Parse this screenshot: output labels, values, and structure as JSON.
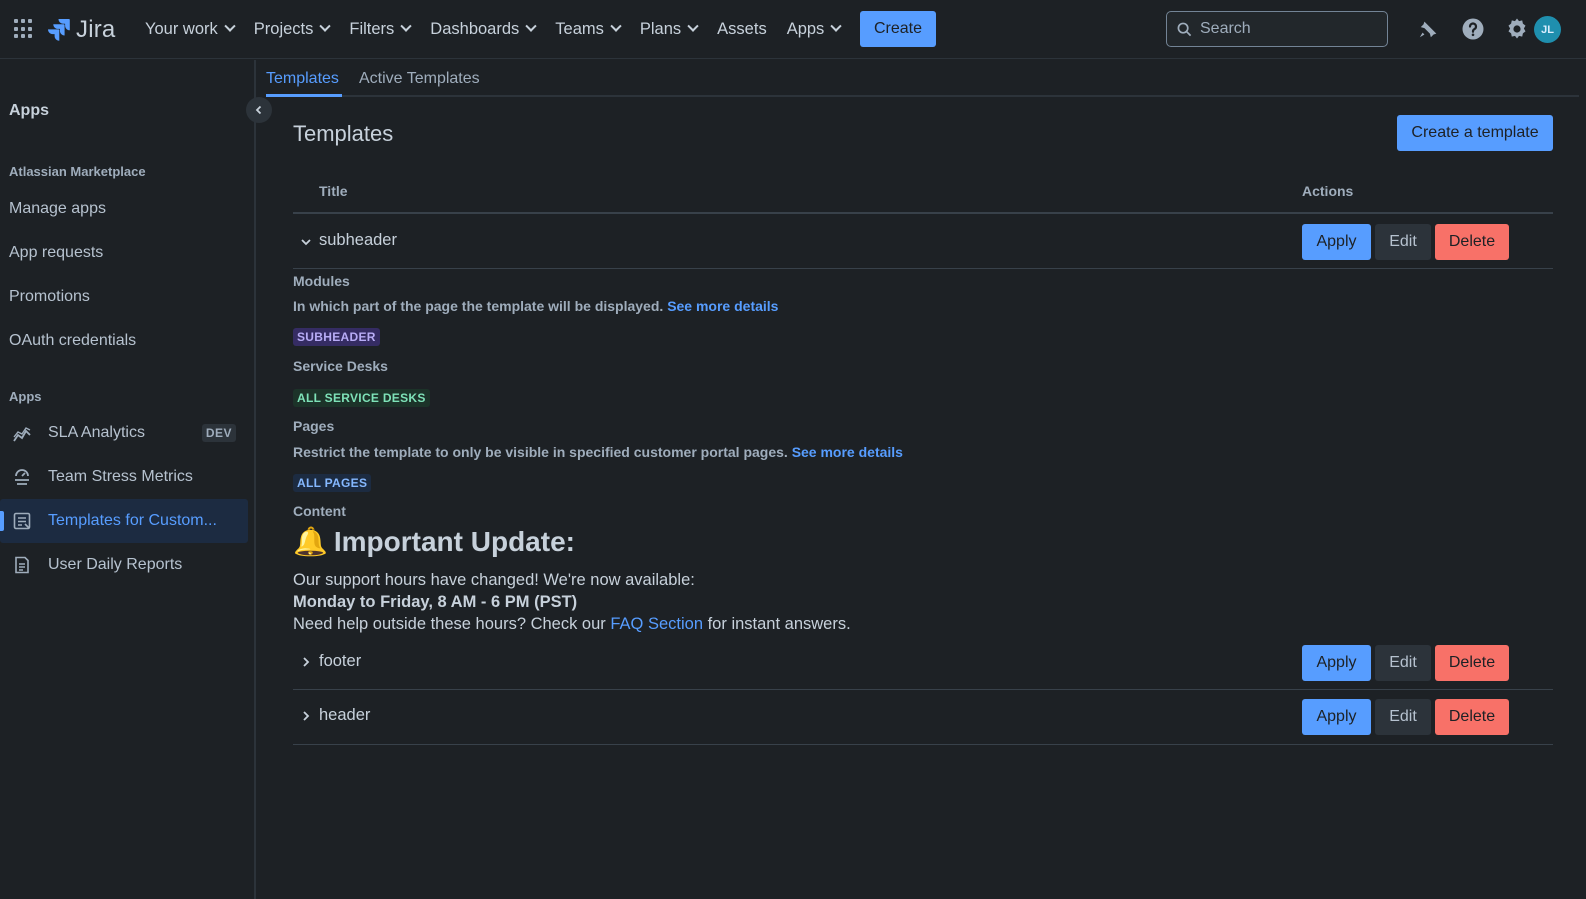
{
  "app": {
    "name": "Jira"
  },
  "topnav": {
    "items": [
      {
        "label": "Your work",
        "dropdown": true
      },
      {
        "label": "Projects",
        "dropdown": true
      },
      {
        "label": "Filters",
        "dropdown": true
      },
      {
        "label": "Dashboards",
        "dropdown": true
      },
      {
        "label": "Teams",
        "dropdown": true
      },
      {
        "label": "Plans",
        "dropdown": true
      },
      {
        "label": "Assets",
        "dropdown": false
      },
      {
        "label": "Apps",
        "dropdown": true
      }
    ],
    "create_label": "Create",
    "search_placeholder": "Search",
    "avatar_initials": "JL"
  },
  "sidebar": {
    "title": "Apps",
    "marketplace_section": "Atlassian Marketplace",
    "marketplace_links": [
      "Manage apps",
      "App requests",
      "Promotions",
      "OAuth credentials"
    ],
    "apps_section": "Apps",
    "apps": [
      {
        "label": "SLA Analytics",
        "badge": "DEV",
        "icon": "chart-icon",
        "active": false
      },
      {
        "label": "Team Stress Metrics",
        "icon": "gauge-icon",
        "active": false
      },
      {
        "label": "Templates for Custom...",
        "icon": "template-icon",
        "active": true
      },
      {
        "label": "User Daily Reports",
        "icon": "report-icon",
        "active": false
      }
    ]
  },
  "tabs": [
    {
      "label": "Templates",
      "active": true
    },
    {
      "label": "Active Templates",
      "active": false
    }
  ],
  "main": {
    "title": "Templates",
    "create_template_label": "Create a template",
    "columns": {
      "title": "Title",
      "actions": "Actions"
    },
    "actions": {
      "apply": "Apply",
      "edit": "Edit",
      "delete": "Delete"
    }
  },
  "templates": [
    {
      "name": "subheader",
      "expanded": true,
      "details": {
        "modules_label": "Modules",
        "modules_desc": "In which part of the page the template will be displayed.",
        "modules_more": "See more details",
        "modules_value": "SUBHEADER",
        "service_desks_label": "Service Desks",
        "service_desks_value": "ALL SERVICE DESKS",
        "pages_label": "Pages",
        "pages_desc": "Restrict the template to only be visible in specified customer portal pages.",
        "pages_more": "See more details",
        "pages_value": "ALL PAGES",
        "content_label": "Content",
        "content_heading_emoji": "🔔",
        "content_heading": "Important Update:",
        "content_line1": "Our support hours have changed! We're now available:",
        "content_line2": "Monday to Friday, 8 AM - 6 PM (PST)",
        "content_line3_pre": "Need help outside these hours? Check our ",
        "content_line3_link": "FAQ Section",
        "content_line3_post": " for instant answers."
      }
    },
    {
      "name": "footer",
      "expanded": false
    },
    {
      "name": "header",
      "expanded": false
    }
  ],
  "colors": {
    "background": "#1d2125",
    "accent": "#579dff",
    "danger": "#f87168"
  }
}
